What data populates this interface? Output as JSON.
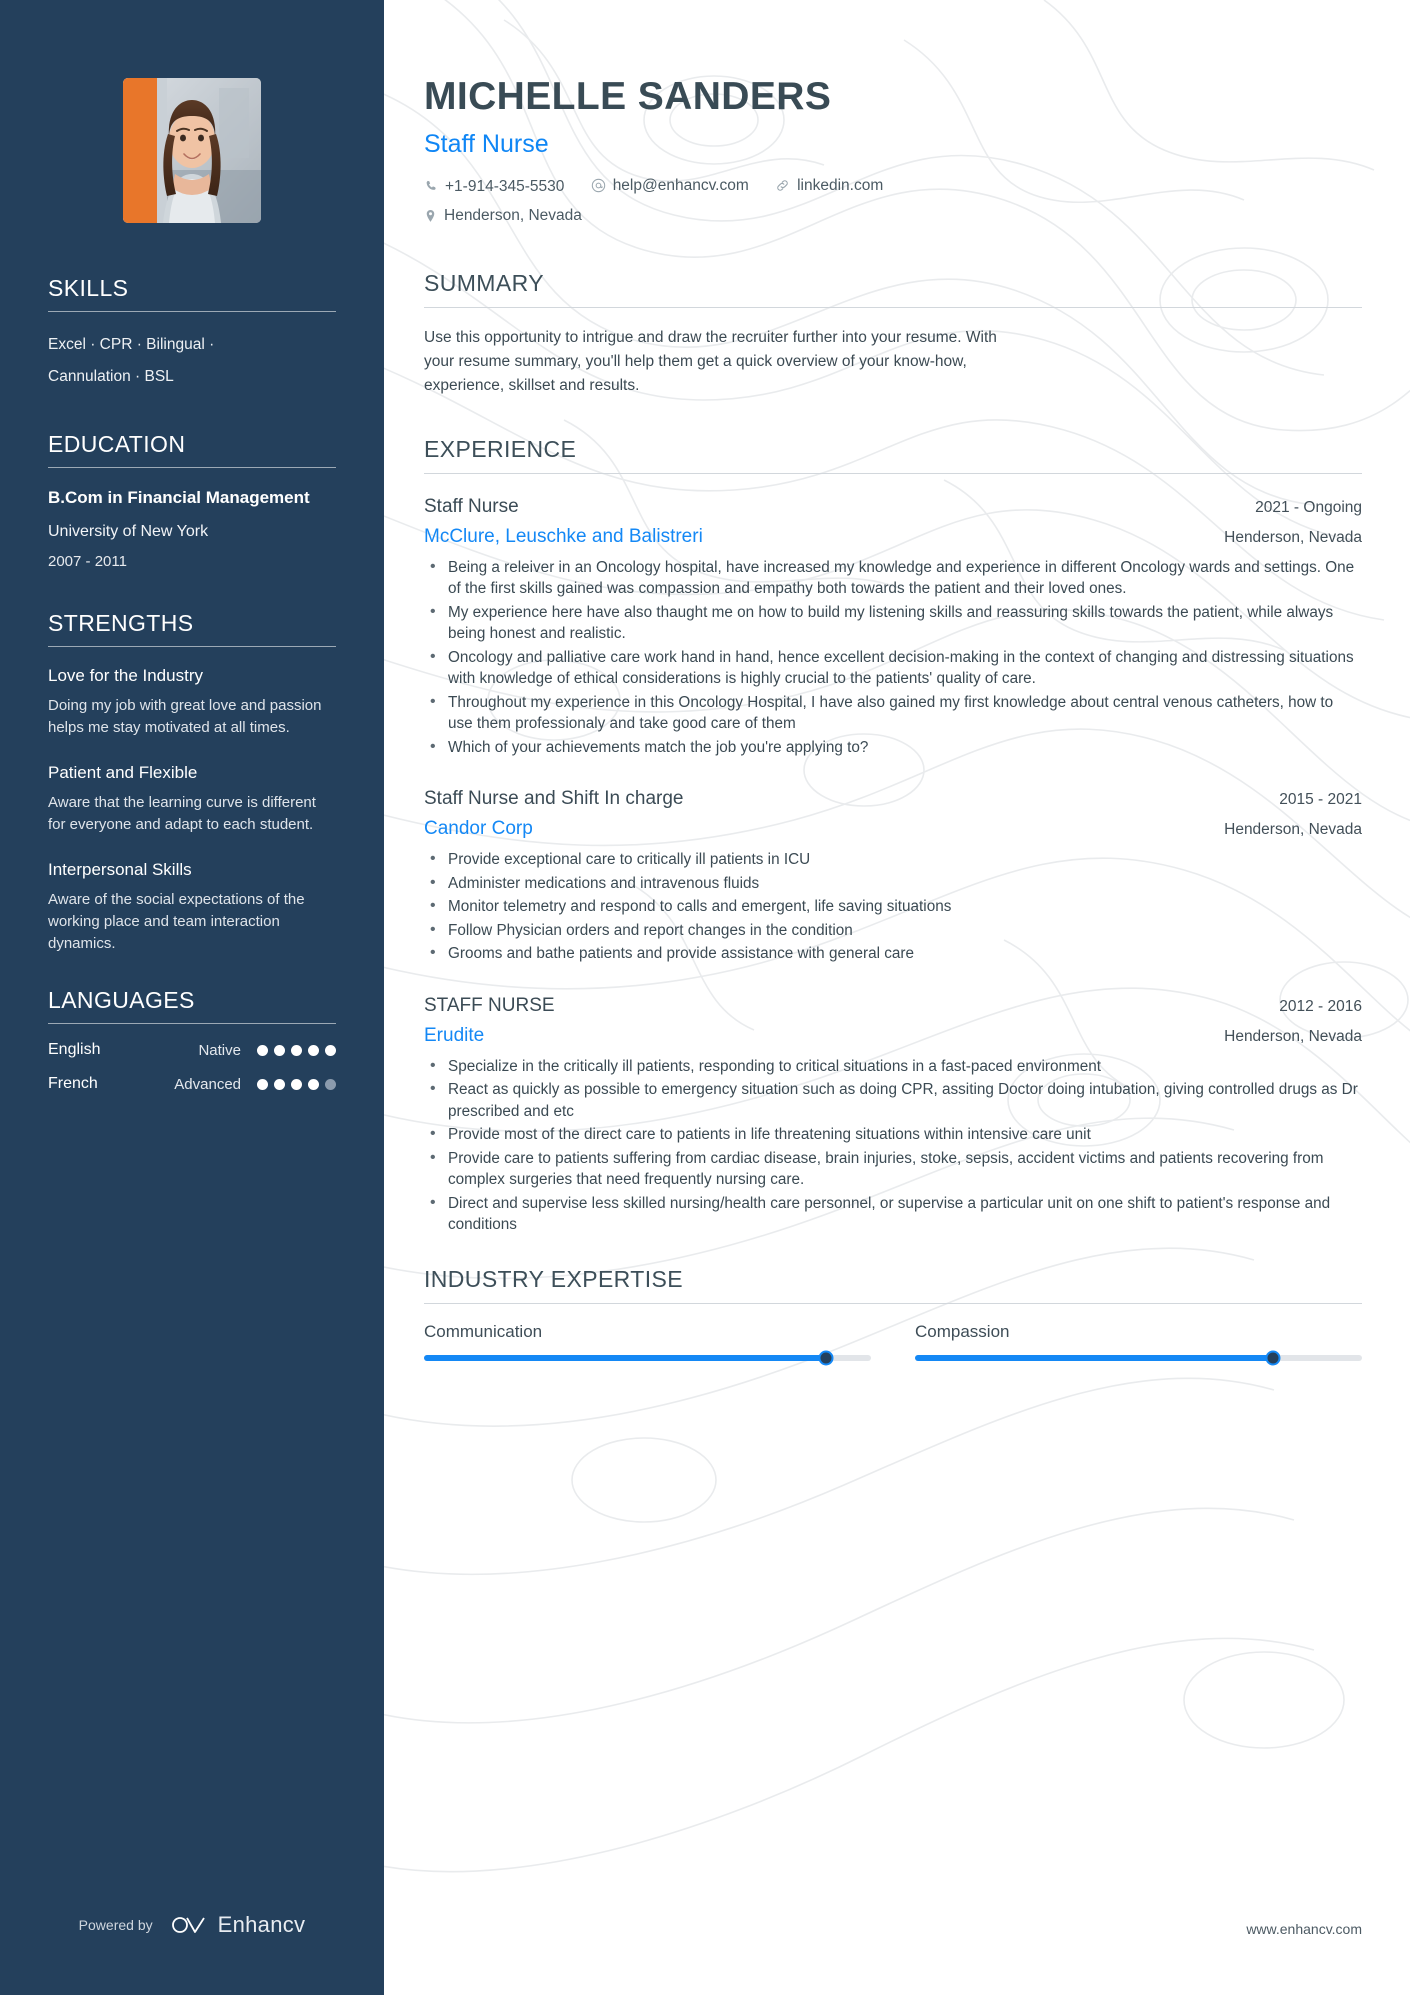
{
  "sidebar": {
    "photo_alt": "profile-photo",
    "skills": {
      "heading": "SKILLS",
      "line1": "Excel · CPR · Bilingual ·",
      "line2": "Cannulation · BSL"
    },
    "education": {
      "heading": "EDUCATION",
      "degree": "B.Com in Financial Management",
      "school": "University of New York",
      "dates": "2007 - 2011"
    },
    "strengths": {
      "heading": "STRENGTHS",
      "items": [
        {
          "title": "Love for the Industry",
          "desc": "Doing my job with great love and passion helps me stay motivated at all times."
        },
        {
          "title": "Patient and Flexible",
          "desc": "Aware that the learning curve is different for everyone and adapt to each student."
        },
        {
          "title": "Interpersonal Skills",
          "desc": "Aware of the social expectations of the working place and team interaction dynamics."
        }
      ]
    },
    "languages": {
      "heading": "LANGUAGES",
      "items": [
        {
          "name": "English",
          "level": "Native",
          "filled": 5,
          "total": 5
        },
        {
          "name": "French",
          "level": "Advanced",
          "filled": 4,
          "total": 5
        }
      ]
    },
    "footer": {
      "powered_by": "Powered by",
      "brand": "Enhancv"
    }
  },
  "header": {
    "name": "MICHELLE SANDERS",
    "role": "Staff Nurse",
    "phone": "+1-914-345-5530",
    "email": "help@enhancv.com",
    "linkedin": "linkedin.com",
    "location": "Henderson, Nevada"
  },
  "summary": {
    "heading": "SUMMARY",
    "text": "Use this opportunity to intrigue and draw the recruiter further into your resume. With your resume summary, you'll help them get a quick overview of your know-how, experience, skillset and results."
  },
  "experience": {
    "heading": "EXPERIENCE",
    "jobs": [
      {
        "title": "Staff Nurse",
        "dates": "2021 - Ongoing",
        "company": "McClure, Leuschke and Balistreri",
        "location": "Henderson, Nevada",
        "bullets": [
          "Being a releiver in an Oncology hospital, have increased my knowledge and experience in different Oncology wards and settings. One of the first skills gained was compassion and empathy both towards the patient and their loved ones.",
          "My experience here have also thaught me on how to build my listening skills and reassuring skills towards the patient, while always being honest and realistic.",
          "Oncology and palliative care work hand in hand, hence excellent decision-making in the context of changing and distressing situations with knowledge of ethical considerations is highly crucial to the patients' quality of care.",
          "Throughout my experience in this Oncology Hospital, I have also gained my first knowledge about central venous catheters, how to use them professionaly and take good care of them",
          "Which of your achievements match the job you're applying to?"
        ]
      },
      {
        "title": "Staff Nurse and Shift In charge",
        "dates": "2015 - 2021",
        "company": "Candor Corp",
        "location": "Henderson, Nevada",
        "bullets": [
          "Provide exceptional care to critically ill patients in ICU",
          "Administer medications and intravenous fluids",
          " Monitor telemetry and respond to calls and emergent, life saving situations",
          "Follow Physician orders and report changes in the condition",
          "Grooms and bathe patients and provide assistance with general care"
        ]
      },
      {
        "title": "STAFF NURSE",
        "dates": "2012 - 2016",
        "company": "Erudite",
        "location": "Henderson, Nevada",
        "bullets": [
          "Specialize in the critically ill patients, responding to critical situations in a fast-paced environment",
          "React as quickly as possible to emergency situation such as doing CPR, assiting Doctor doing intubation, giving controlled drugs as Dr prescribed and etc",
          "Provide most of the direct care to patients in life threatening situations within intensive care unit",
          "Provide care to patients suffering from cardiac disease, brain injuries, stoke, sepsis, accident victims and patients recovering from complex surgeries that need frequently nursing care.",
          "Direct and supervise less skilled nursing/health care personnel, or supervise a particular unit on one shift to patient's response and conditions"
        ]
      }
    ]
  },
  "industry_expertise": {
    "heading": "INDUSTRY EXPERTISE",
    "items": [
      {
        "label": "Communication",
        "value": 90
      },
      {
        "label": "Compassion",
        "value": 80
      }
    ]
  },
  "page_footer": {
    "website": "www.enhancv.com"
  },
  "colors": {
    "sidebar_bg": "#24405c",
    "accent": "#1488f5",
    "heading": "#3d4f59",
    "body": "#3b4a53"
  }
}
